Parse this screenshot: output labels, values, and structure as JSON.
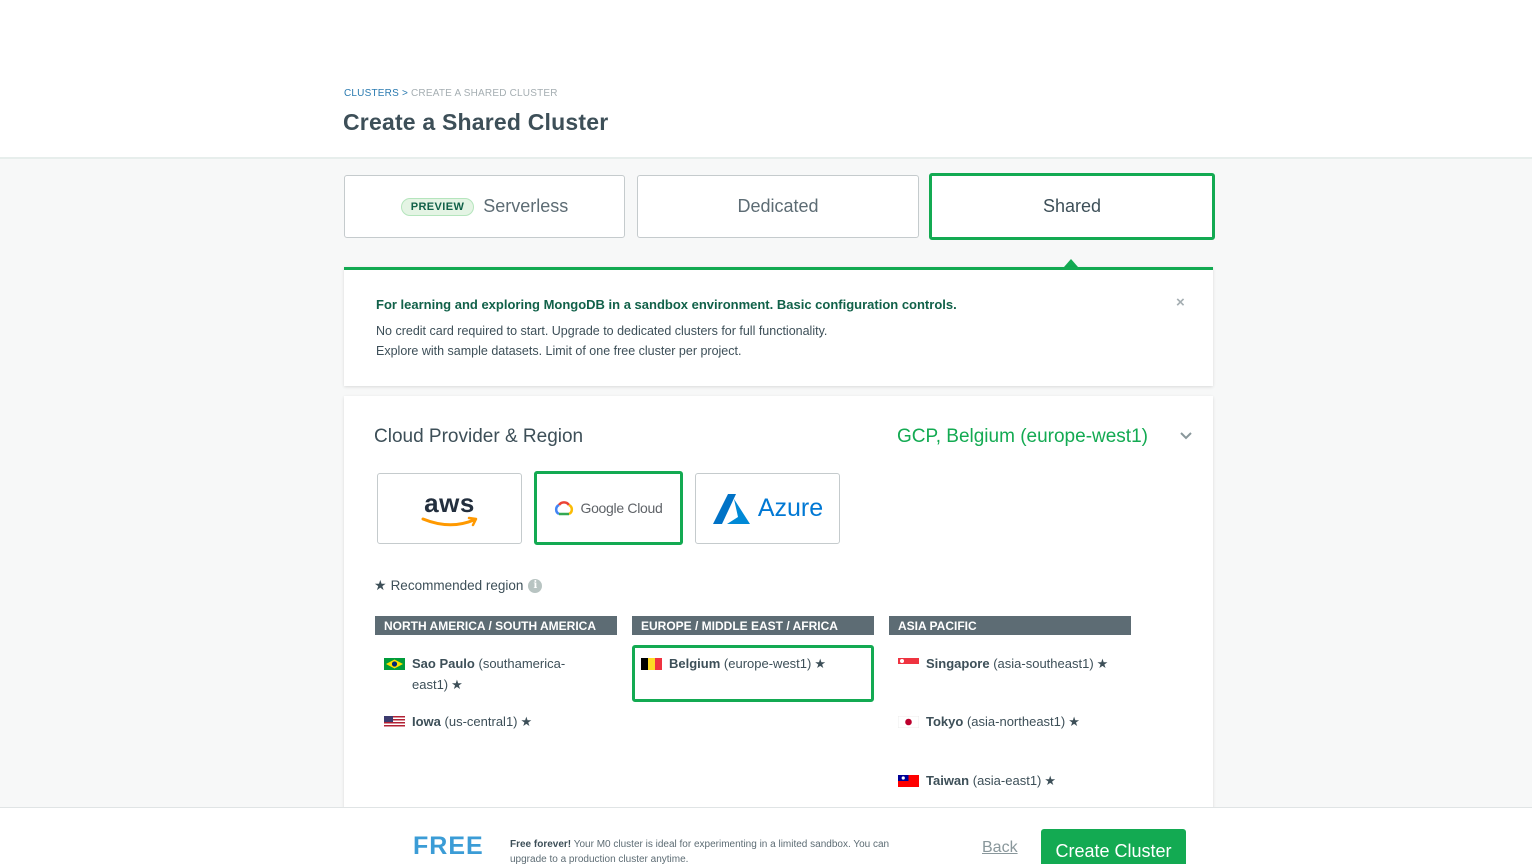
{
  "breadcrumb": {
    "parent": "CLUSTERS",
    "separator": ">",
    "current": "CREATE A SHARED CLUSTER"
  },
  "page_title": "Create a Shared Cluster",
  "cluster_types": {
    "serverless": {
      "badge": "PREVIEW",
      "label": "Serverless"
    },
    "dedicated": {
      "label": "Dedicated"
    },
    "shared": {
      "label": "Shared",
      "selected": true
    }
  },
  "info_banner": {
    "title": "For learning and exploring MongoDB in a sandbox environment. Basic configuration controls.",
    "line1": "No credit card required to start. Upgrade to dedicated clusters for full functionality.",
    "line2": "Explore with sample datasets. Limit of one free cluster per project.",
    "close": "×"
  },
  "provider_section": {
    "title": "Cloud Provider & Region",
    "selected_summary": "GCP, Belgium (europe-west1)",
    "providers": [
      {
        "name": "aws",
        "label": "aws"
      },
      {
        "name": "gcp",
        "label": "Google Cloud",
        "selected": true
      },
      {
        "name": "azure",
        "label": "Azure"
      }
    ],
    "recommended_label": "Recommended region",
    "recommended_star": "★",
    "info_glyph": "i",
    "groups": {
      "na": {
        "header": "NORTH AMERICA / SOUTH AMERICA",
        "regions": [
          {
            "name": "Sao Paulo",
            "code_line1": "(southamerica-",
            "code_line2": "east1)",
            "recommended": true
          },
          {
            "name": "Iowa",
            "code": "(us-central1)",
            "recommended": true
          }
        ]
      },
      "eu": {
        "header": "EUROPE / MIDDLE EAST / AFRICA",
        "regions": [
          {
            "name": "Belgium",
            "code": "(europe-west1)",
            "recommended": true,
            "selected": true
          }
        ]
      },
      "ap": {
        "header": "ASIA PACIFIC",
        "regions": [
          {
            "name": "Singapore",
            "code": "(asia-southeast1)",
            "recommended": true
          },
          {
            "name": "Tokyo",
            "code": "(asia-northeast1)",
            "recommended": true
          },
          {
            "name": "Taiwan",
            "code": "(asia-east1)",
            "recommended": true
          }
        ]
      }
    }
  },
  "footer": {
    "price_label": "FREE",
    "desc_bold": "Free forever!",
    "desc_rest": " Your M0 cluster is ideal for experimenting in a limited sandbox. You can upgrade to a production cluster anytime.",
    "back_label": "Back",
    "create_label": "Create Cluster"
  },
  "colors": {
    "accent_green": "#13aa52",
    "dark_green": "#116149",
    "free_blue": "#3b9cd6",
    "header_gray": "#5d6c74"
  }
}
